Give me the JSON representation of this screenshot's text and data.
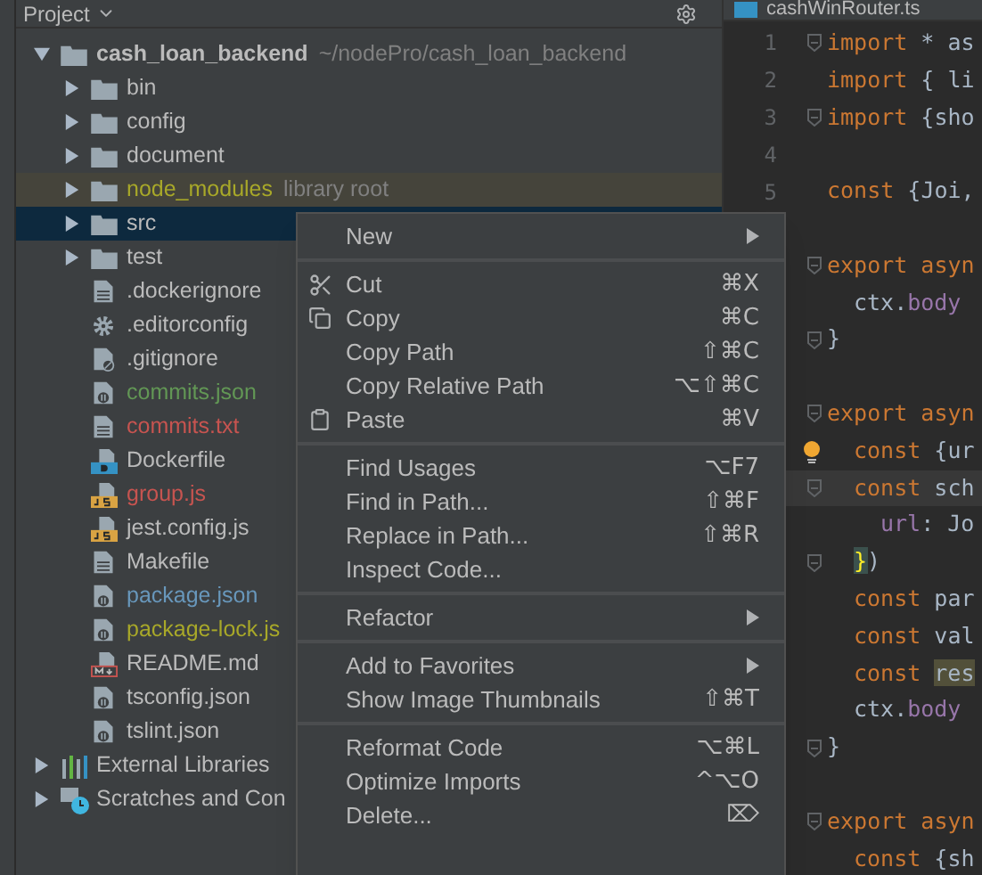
{
  "project_panel": {
    "title": "Project"
  },
  "tree": [
    {
      "label": "cash_loan_backend",
      "note": "~/nodePro/cash_loan_backend",
      "kind": "folder",
      "expanded": true,
      "selected": false,
      "children": [
        {
          "label": "bin",
          "kind": "folder",
          "expanded": false,
          "selected": false
        },
        {
          "label": "config",
          "kind": "folder",
          "expanded": false,
          "selected": false
        },
        {
          "label": "document",
          "kind": "folder",
          "expanded": false,
          "selected": false
        },
        {
          "label": "node_modules",
          "note": "library root",
          "kind": "folder",
          "expanded": false,
          "selected": false,
          "color": "#a8a829"
        },
        {
          "label": "src",
          "kind": "folder",
          "expanded": false,
          "selected": true
        },
        {
          "label": "test",
          "kind": "folder",
          "expanded": false,
          "selected": false
        },
        {
          "label": ".dockerignore",
          "kind": "text",
          "selected": false
        },
        {
          "label": ".editorconfig",
          "kind": "config",
          "selected": false
        },
        {
          "label": ".gitignore",
          "kind": "ignore",
          "selected": false
        },
        {
          "label": "commits.json",
          "kind": "json",
          "selected": false,
          "color": "#629755"
        },
        {
          "label": "commits.txt",
          "kind": "text",
          "selected": false,
          "color": "#c75450"
        },
        {
          "label": "Dockerfile",
          "kind": "docker",
          "selected": false
        },
        {
          "label": "group.js",
          "kind": "js",
          "selected": false,
          "color": "#c75450"
        },
        {
          "label": "jest.config.js",
          "kind": "js",
          "selected": false
        },
        {
          "label": "Makefile",
          "kind": "text",
          "selected": false
        },
        {
          "label": "package.json",
          "kind": "json",
          "selected": false,
          "color": "#6897bb"
        },
        {
          "label": "package-lock.js",
          "kind": "json",
          "selected": false,
          "color": "#a8a829"
        },
        {
          "label": "README.md",
          "kind": "markdown",
          "selected": false
        },
        {
          "label": "tsconfig.json",
          "kind": "json",
          "selected": false
        },
        {
          "label": "tslint.json",
          "kind": "json",
          "selected": false
        }
      ]
    },
    {
      "label": "External Libraries",
      "kind": "libraries",
      "expanded": false,
      "selected": false
    },
    {
      "label": "Scratches and Con",
      "kind": "scratches",
      "expanded": false,
      "selected": false
    }
  ],
  "editor": {
    "tab": "cashWinRouter.ts",
    "lines": [
      {
        "number": "1",
        "kind": "top",
        "fold": true,
        "bulb": false,
        "current": false,
        "tokens": [
          {
            "kind": "keyword",
            "text": "import"
          },
          {
            "kind": "plain",
            "text": " * as"
          }
        ]
      },
      {
        "number": "2",
        "kind": "top",
        "fold": false,
        "bulb": false,
        "current": false,
        "tokens": [
          {
            "kind": "keyword",
            "text": "import"
          },
          {
            "kind": "plain",
            "text": " { li"
          }
        ]
      },
      {
        "number": "3",
        "kind": "top",
        "fold": true,
        "bulb": false,
        "current": false,
        "tokens": [
          {
            "kind": "keyword",
            "text": "import"
          },
          {
            "kind": "plain",
            "text": " {sho"
          }
        ]
      },
      {
        "number": "4",
        "fold": false,
        "bulb": false,
        "current": false
      },
      {
        "number": "5",
        "kind": "top",
        "fold": false,
        "bulb": false,
        "current": false,
        "tokens": [
          {
            "kind": "keyword",
            "text": "const"
          },
          {
            "kind": "plain",
            "text": " {Joi,"
          }
        ]
      },
      {
        "fold": false,
        "bulb": false,
        "current": false
      },
      {
        "kind": "top",
        "fold": true,
        "bulb": false,
        "current": false,
        "tokens": [
          {
            "kind": "keyword",
            "text": "export asyn"
          }
        ]
      },
      {
        "kind": "body",
        "fold": false,
        "bulb": false,
        "current": false,
        "tokens": [
          {
            "kind": "plain",
            "text": "ctx."
          },
          {
            "kind": "member",
            "text": "body"
          }
        ]
      },
      {
        "kind": "top",
        "fold": true,
        "bulb": false,
        "current": false,
        "tokens": [
          {
            "kind": "plain",
            "text": "}"
          }
        ]
      },
      {
        "fold": false,
        "bulb": false,
        "current": false
      },
      {
        "kind": "top",
        "fold": true,
        "bulb": false,
        "current": false,
        "tokens": [
          {
            "kind": "keyword",
            "text": "export asyn"
          }
        ]
      },
      {
        "kind": "body",
        "fold": false,
        "bulb": true,
        "current": false,
        "tokens": [
          {
            "kind": "keyword",
            "text": "const"
          },
          {
            "kind": "plain",
            "text": " {ur"
          }
        ]
      },
      {
        "kind": "body",
        "fold": true,
        "bulb": false,
        "current": true,
        "tokens": [
          {
            "kind": "keyword",
            "text": "const"
          },
          {
            "kind": "plain",
            "text": " sch"
          }
        ]
      },
      {
        "kind": "inner",
        "fold": false,
        "bulb": false,
        "current": false,
        "tokens": [
          {
            "kind": "member",
            "text": "url"
          },
          {
            "kind": "plain",
            "text": ": Jo"
          }
        ]
      },
      {
        "kind": "body",
        "fold": true,
        "bulb": false,
        "current": false,
        "tokens": [
          {
            "kind": "brace",
            "text": "}"
          },
          {
            "kind": "plain",
            "text": ")"
          }
        ]
      },
      {
        "kind": "body",
        "fold": false,
        "bulb": false,
        "current": false,
        "tokens": [
          {
            "kind": "keyword",
            "text": "const"
          },
          {
            "kind": "plain",
            "text": " par"
          }
        ]
      },
      {
        "kind": "body",
        "fold": false,
        "bulb": false,
        "current": false,
        "tokens": [
          {
            "kind": "keyword",
            "text": "const"
          },
          {
            "kind": "plain",
            "text": " val"
          }
        ]
      },
      {
        "kind": "body",
        "fold": false,
        "bulb": false,
        "current": false,
        "tokens": [
          {
            "kind": "keyword",
            "text": "const "
          },
          {
            "kind": "match",
            "text": "res"
          }
        ]
      },
      {
        "kind": "body",
        "fold": false,
        "bulb": false,
        "current": false,
        "tokens": [
          {
            "kind": "plain",
            "text": "ctx."
          },
          {
            "kind": "member",
            "text": "body"
          }
        ]
      },
      {
        "kind": "top",
        "fold": true,
        "bulb": false,
        "current": false,
        "tokens": [
          {
            "kind": "plain",
            "text": "}"
          }
        ]
      },
      {
        "fold": false,
        "bulb": false,
        "current": false
      },
      {
        "kind": "top",
        "fold": true,
        "bulb": false,
        "current": false,
        "tokens": [
          {
            "kind": "keyword",
            "text": "export asyn"
          }
        ]
      },
      {
        "kind": "body",
        "fold": false,
        "bulb": false,
        "current": false,
        "tokens": [
          {
            "kind": "keyword",
            "text": "const"
          },
          {
            "kind": "plain",
            "text": " {sh"
          }
        ]
      }
    ]
  },
  "context_menu": [
    [
      {
        "label": "New",
        "kind": "plain",
        "submenu": true
      }
    ],
    [
      {
        "label": "Cut",
        "kind": "cut",
        "shortcut": "⌘X",
        "submenu": false
      },
      {
        "label": "Copy",
        "kind": "copy",
        "shortcut": "⌘C",
        "submenu": false
      },
      {
        "label": "Copy Path",
        "kind": "plain",
        "shortcut": "⇧⌘C",
        "submenu": false
      },
      {
        "label": "Copy Relative Path",
        "kind": "plain",
        "shortcut": "⌥⇧⌘C",
        "submenu": false
      },
      {
        "label": "Paste",
        "kind": "paste",
        "shortcut": "⌘V",
        "submenu": false
      }
    ],
    [
      {
        "label": "Find Usages",
        "kind": "plain",
        "shortcut": "⌥F7",
        "submenu": false
      },
      {
        "label": "Find in Path...",
        "kind": "plain",
        "shortcut": "⇧⌘F",
        "submenu": false
      },
      {
        "label": "Replace in Path...",
        "kind": "plain",
        "shortcut": "⇧⌘R",
        "submenu": false
      },
      {
        "label": "Inspect Code...",
        "kind": "plain",
        "submenu": false
      }
    ],
    [
      {
        "label": "Refactor",
        "kind": "plain",
        "submenu": true
      }
    ],
    [
      {
        "label": "Add to Favorites",
        "kind": "plain",
        "submenu": true
      },
      {
        "label": "Show Image Thumbnails",
        "kind": "plain",
        "shortcut": "⇧⌘T",
        "submenu": false
      }
    ],
    [
      {
        "label": "Reformat Code",
        "kind": "plain",
        "shortcut": "⌥⌘L",
        "submenu": false
      },
      {
        "label": "Optimize Imports",
        "kind": "plain",
        "shortcut": "^⌥O",
        "submenu": false
      },
      {
        "label": "Delete...",
        "kind": "plain",
        "shortcut": "⌦",
        "submenu": false
      }
    ]
  ]
}
